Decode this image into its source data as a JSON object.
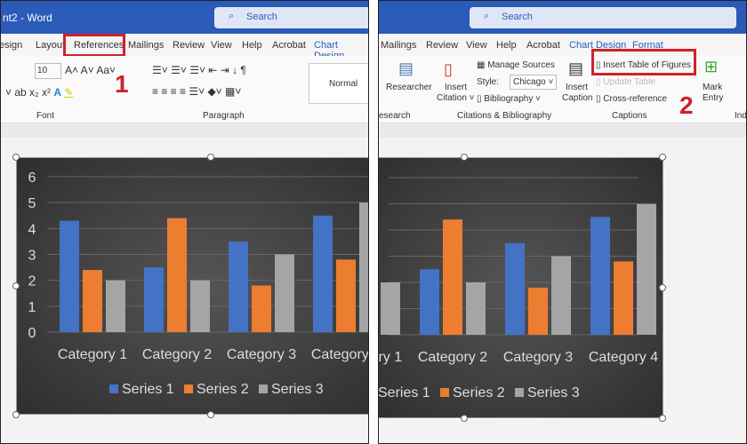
{
  "left": {
    "title": "nt2 - Word",
    "search": "Search",
    "tabs": [
      "esign",
      "Layout",
      "References",
      "Mailings",
      "Review",
      "View",
      "Help",
      "Acrobat",
      "Chart Design"
    ],
    "font_size": "10",
    "style_normal": "Normal",
    "groups": [
      "Font",
      "Paragraph"
    ],
    "step": "1"
  },
  "right": {
    "search": "Search",
    "tabs": [
      "Mailings",
      "Review",
      "View",
      "Help",
      "Acrobat",
      "Chart Design",
      "Format"
    ],
    "researcher": "Researcher",
    "research_group": "esearch",
    "insert_citation": [
      "Insert",
      "Citation ˅"
    ],
    "manage_sources": "Manage Sources",
    "style_label": "Style:",
    "style_value": "Chicago",
    "bibliography": "Bibliography ˅",
    "citations_group": "Citations & Bibliography",
    "insert_caption": [
      "Insert",
      "Caption"
    ],
    "insert_tof": "Insert Table of Figures",
    "update_table": "Update Table",
    "cross_reference": "Cross-reference",
    "captions_group": "Captions",
    "mark_entry": [
      "Mark",
      "Entry"
    ],
    "index_group": "Ind",
    "step": "2"
  },
  "chart_data": {
    "type": "bar",
    "categories": [
      "Category 1",
      "Category 2",
      "Category 3",
      "Category 4"
    ],
    "series": [
      {
        "name": "Series 1",
        "values": [
          4.3,
          2.5,
          3.5,
          4.5
        ],
        "color": "#4472C4"
      },
      {
        "name": "Series 2",
        "values": [
          2.4,
          4.4,
          1.8,
          2.8
        ],
        "color": "#ED7D31"
      },
      {
        "name": "Series 3",
        "values": [
          2,
          2,
          3,
          5
        ],
        "color": "#A5A5A5"
      }
    ],
    "ylim": [
      0,
      6
    ],
    "yticks": [
      0,
      1,
      2,
      3,
      4,
      5,
      6
    ],
    "grid": true,
    "legend": "bottom"
  },
  "colors": {
    "accent": "#2b5bb8",
    "highlight": "#d0202a"
  }
}
